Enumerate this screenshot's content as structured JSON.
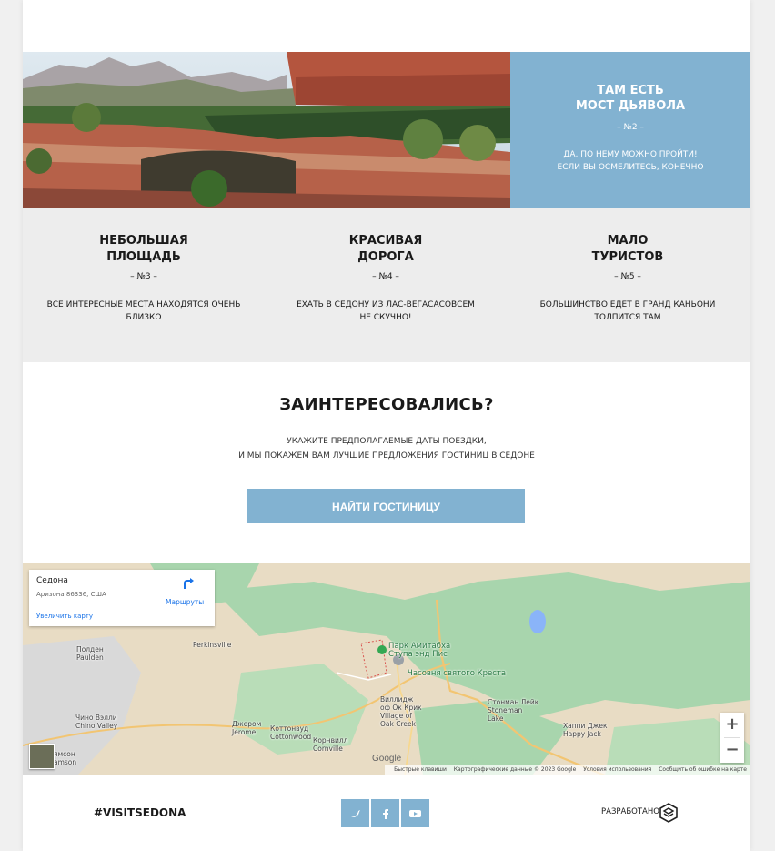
{
  "hero": {
    "title_line1": "ТАМ ЕСТЬ",
    "title_line2": "МОСТ ДЬЯВОЛА",
    "number": "– №2 –",
    "desc_line1": "ДА, ПО НЕМУ МОЖНО ПРОЙТИ!",
    "desc_line2": "ЕСЛИ ВЫ ОСМЕЛИТЕСЬ, КОНЕЧНО"
  },
  "features": [
    {
      "title_line1": "НЕБОЛЬШАЯ",
      "title_line2": "ПЛОЩАДЬ",
      "number": "– №3 –",
      "desc_line1": "ВСЕ ИНТЕРЕСНЫЕ МЕСТА НАХОДЯТСЯ ОЧЕНЬ",
      "desc_line2": "БЛИЗКО"
    },
    {
      "title_line1": "КРАСИВАЯ",
      "title_line2": "ДОРОГА",
      "number": "– №4 –",
      "desc_line1": "ЕХАТЬ В СЕДОНУ ИЗ ЛАС-ВЕГАСАСОВСЕМ",
      "desc_line2": "НЕ СКУЧНО!"
    },
    {
      "title_line1": "МАЛО",
      "title_line2": "ТУРИСТОВ",
      "number": "– №5 –",
      "desc_line1": "БОЛЬШИНСТВО ЕДЕТ В ГРАНД КАНЬОНИ",
      "desc_line2": "ТОЛПИТСЯ ТАМ"
    }
  ],
  "cta": {
    "title": "ЗАИНТЕРЕСОВАЛИСЬ?",
    "text_line1": "УКАЖИТЕ ПРЕДПОЛАГАЕМЫЕ ДАТЫ ПОЕЗДКИ,",
    "text_line2": "И МЫ ПОКАЖЕМ ВАМ ЛУЧШИЕ ПРЕДЛОЖЕНИЯ ГОСТИНИЦ В СЕДОНЕ",
    "button": "НАЙТИ ГОСТИНИЦУ"
  },
  "map": {
    "place_name": "Седона",
    "place_address": "Аризона 86336, США",
    "routes": "Маршруты",
    "enlarge": "Увеличить карту",
    "zoom_in": "+",
    "zoom_out": "−",
    "google": "Google",
    "labels": {
      "poulden": "Полден\nPaulden",
      "perkinsville": "Perkinsville",
      "chino": "Чино Вэлли\nChino Valley",
      "jerome": "Джером\nJerome",
      "cottonwood": "Коттонвуд\nCottonwood",
      "cornville": "Корнвилл\nCornville",
      "village": "Виллидж\nоф Ок Крик\nVillage of\nOak Creek",
      "stoneman": "Стонман Лейк\nStoneman\nLake",
      "happy_jack": "Хаппи Джек\nHappy Jack",
      "williamson": "ямсон\namson",
      "stupa": "Парк Амитабха\nСтупа энд Пис",
      "chapel": "Часовня святого Креста"
    },
    "attribution": [
      "Быстрые клавиши",
      "Картографические данные © 2023 Google",
      "Условия использования",
      "Сообщить об ошибке на карте"
    ]
  },
  "footer": {
    "hashtag": "#VISITSEDONA",
    "developed": "РАЗРАБОТАНО",
    "social": [
      "twitter-icon",
      "facebook-icon",
      "youtube-icon"
    ]
  },
  "colors": {
    "accent": "#82b2d1",
    "features_bg": "#ededed",
    "map_green": "#a8d5a8"
  }
}
